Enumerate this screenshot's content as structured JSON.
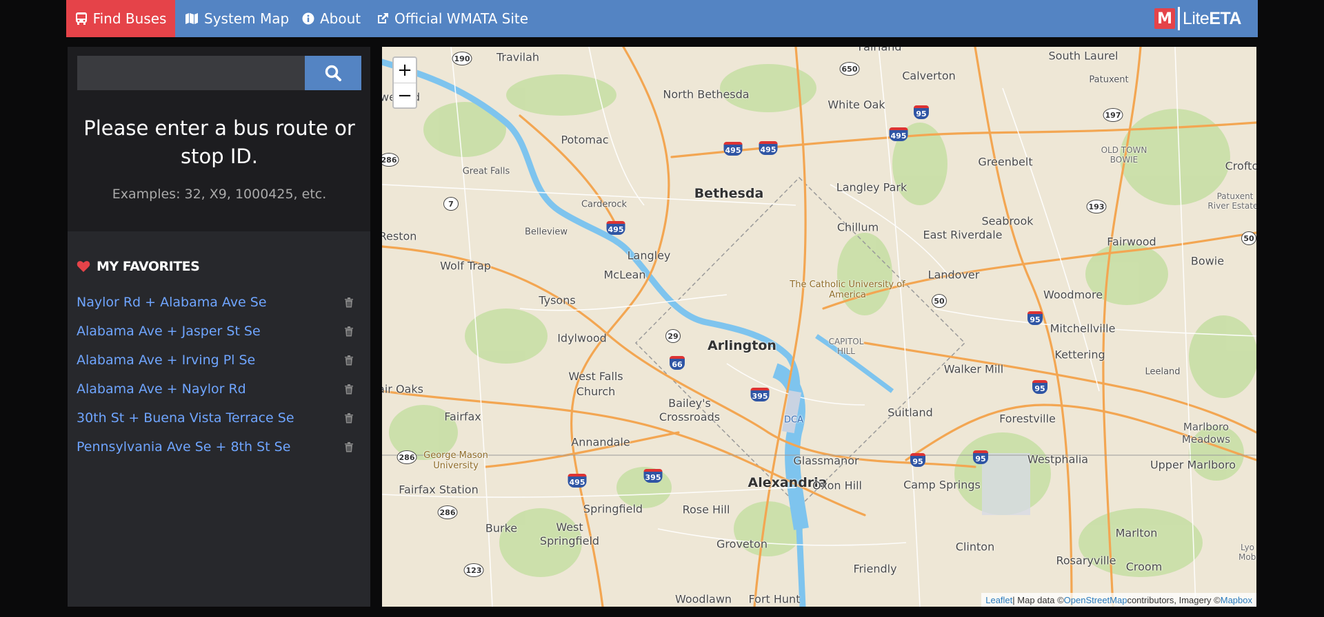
{
  "nav": {
    "find_buses": "Find Buses",
    "system_map": "System Map",
    "about": "About",
    "official_site": "Official WMATA Site",
    "brand_mark": "M",
    "brand_lite": "Lite",
    "brand_eta": "ETA"
  },
  "search": {
    "value": "",
    "placeholder": "",
    "prompt": "Please enter a bus route or stop ID.",
    "examples": "Examples: 32, X9, 1000425, etc."
  },
  "favorites": {
    "header": "MY FAVORITES",
    "items": [
      {
        "label": "Naylor Rd + Alabama Ave Se"
      },
      {
        "label": "Alabama Ave + Jasper St Se"
      },
      {
        "label": "Alabama Ave + Irving Pl Se"
      },
      {
        "label": "Alabama Ave + Naylor Rd"
      },
      {
        "label": "30th St + Buena Vista Terrace Se"
      },
      {
        "label": "Pennsylvania Ave Se + 8th St Se"
      }
    ]
  },
  "map": {
    "zoom_in": "+",
    "zoom_out": "−",
    "attribution": {
      "leaflet": "Leaflet",
      "sep": " | Map data © ",
      "osm": "OpenStreetMap",
      "mid": " contributors, Imagery © ",
      "mapbox": "Mapbox"
    },
    "places": {
      "travilah": "Travilah",
      "north_bethesda": "North Bethesda",
      "fairland": "Fairland",
      "south_laurel": "South Laurel",
      "calverton": "Calverton",
      "white_oak": "White Oak",
      "patuxent": "Patuxent",
      "potomac": "Potomac",
      "greenbelt": "Greenbelt",
      "old_town_bowie": "OLD TOWN BOWIE",
      "crofton": "Crofton",
      "great_falls": "Great Falls",
      "bethesda": "Bethesda",
      "langley_park": "Langley Park",
      "patuxent_river_estates": "Patuxent River Estates",
      "carderock": "Carderock",
      "chillum": "Chillum",
      "seabrook": "Seabrook",
      "reston": "Reston",
      "belleview": "Belleview",
      "east_riverdale": "East Riverdale",
      "fairwood": "Fairwood",
      "langley": "Langley",
      "wolf_trap": "Wolf Trap",
      "bowie": "Bowie",
      "mclean": "McLean",
      "landover": "Landover",
      "catholic_university": "The Catholic University of America",
      "tysons": "Tysons",
      "woodmore": "Woodmore",
      "mitchellville": "Mitchellville",
      "idylwood": "Idylwood",
      "arlington": "Arlington",
      "capitol_hill": "CAPITOL HILL",
      "kettering": "Kettering",
      "walker_mill": "Walker Mill",
      "leeland": "Leeland",
      "west_falls_church": "West Falls Church",
      "fair_oaks": "air Oaks",
      "baileys_crossroads": "Bailey's Crossroads",
      "dca": "DCA",
      "suitland": "Suitland",
      "forestville": "Forestville",
      "fairfax": "Fairfax",
      "marlboro_meadows": "Marlboro Meadows",
      "annandale": "Annandale",
      "george_mason": "George Mason University",
      "glassmanor": "Glassmanor",
      "westphalia": "Westphalia",
      "upper_marlboro": "Upper Marlboro",
      "alexandria": "Alexandria",
      "oxon_hill": "Oxon Hill",
      "camp_springs": "Camp Springs",
      "fairfax_station": "Fairfax Station",
      "springfield": "Springfield",
      "rose_hill": "Rose Hill",
      "burke": "Burke",
      "west_springfield": "West Springfield",
      "marlton": "Marlton",
      "groveton": "Groveton",
      "clinton": "Clinton",
      "rosaryville": "Rosaryville",
      "friendly": "Friendly",
      "croom": "Croom",
      "lyon_mobile": "Lyo Mobi",
      "woodlawn": "Woodlawn",
      "fort_hunt": "Fort Hunt",
      "wand": "we and"
    },
    "shields": {
      "s190": "190",
      "s650": "650",
      "s95a": "95",
      "s197": "197",
      "s495a": "495",
      "s495b": "495",
      "s495c": "495",
      "s286a": "286",
      "s7": "7",
      "s193": "193",
      "s495d": "495",
      "s50a": "50",
      "s50b": "50",
      "s29": "29",
      "s95b": "95",
      "s66": "66",
      "s395a": "395",
      "s95c": "95",
      "s286b": "286",
      "s495e": "495",
      "s395b": "395",
      "s95d": "95",
      "s95e": "95",
      "s286c": "286",
      "s123": "123"
    }
  }
}
